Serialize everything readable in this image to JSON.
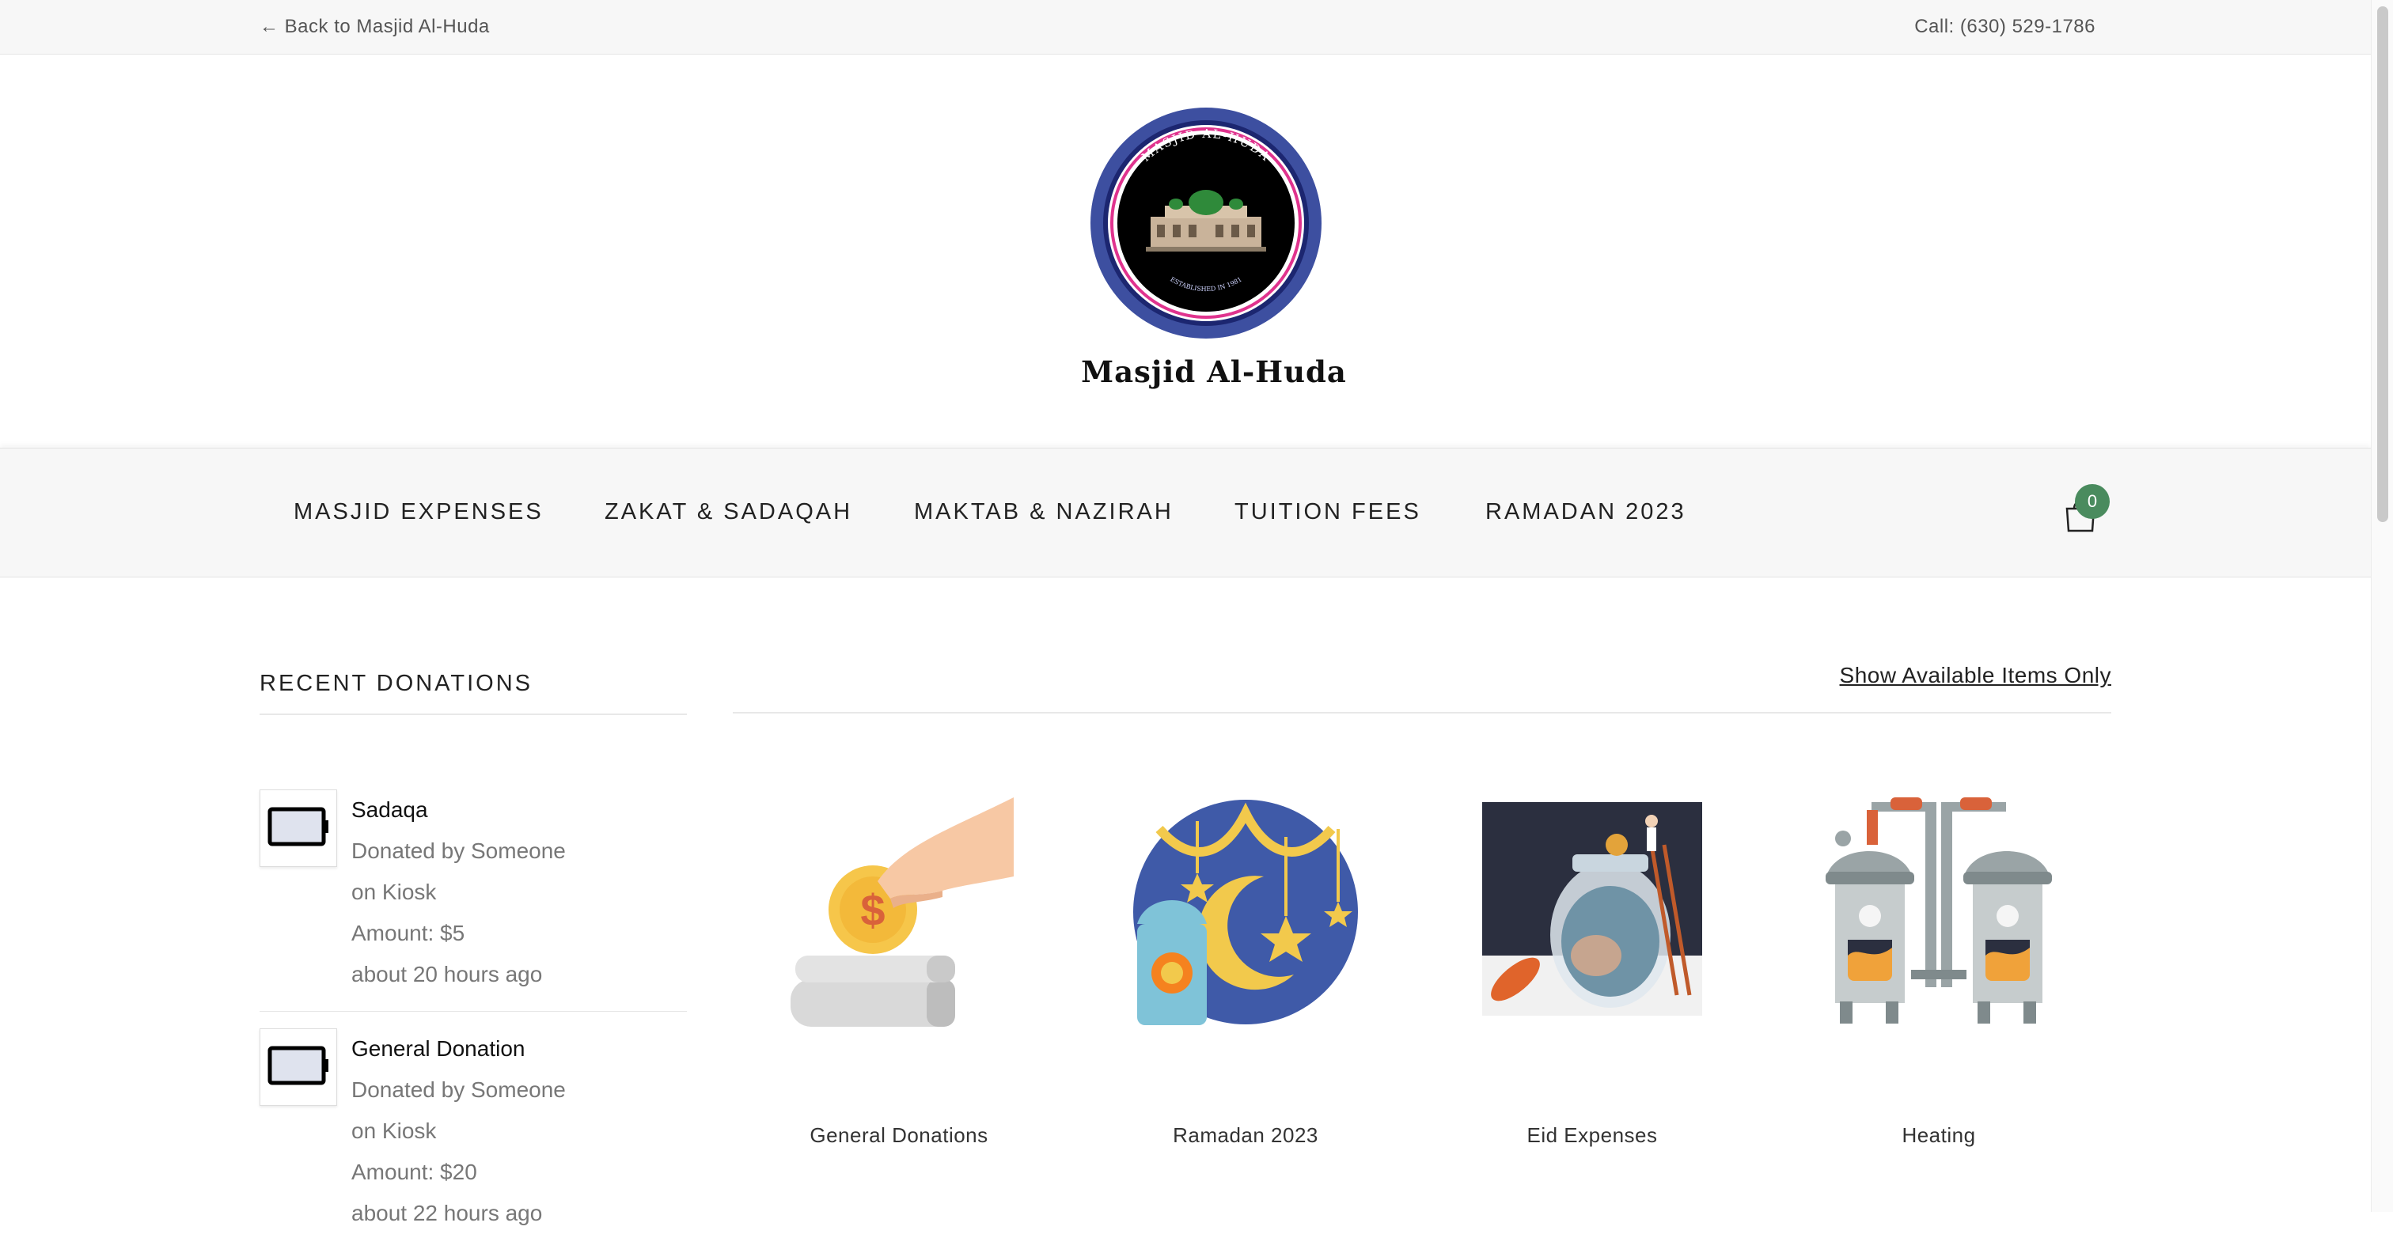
{
  "topbar": {
    "back_label": "← Back to Masjid Al-Huda",
    "phone": "Call: (630) 529-1786"
  },
  "brand": {
    "title": "Masjid Al-Huda",
    "logo_icon": "masjid-seal-logo",
    "logo_ring_text": "MASJID AL-HUDA",
    "logo_bottom_text": "ESTABLISHED IN 1981"
  },
  "nav": {
    "items": [
      {
        "label": "MASJID EXPENSES"
      },
      {
        "label": "ZAKAT & SADAQAH"
      },
      {
        "label": "MAKTAB & NAZIRAH"
      },
      {
        "label": "TUITION FEES"
      },
      {
        "label": "RAMADAN 2023"
      }
    ],
    "cart_icon": "shopping-bag-icon",
    "cart_count": "0"
  },
  "sidebar": {
    "title": "RECENT DONATIONS",
    "donations": [
      {
        "title": "Sadaqa",
        "by": "Donated by Someone",
        "via": "on Kiosk",
        "amount": "Amount: $5",
        "time": "about 20 hours ago",
        "icon": "battery-icon"
      },
      {
        "title": "General Donation",
        "by": "Donated by Someone",
        "via": "on Kiosk",
        "amount": "Amount: $20",
        "time": "about 22 hours ago",
        "icon": "battery-icon"
      }
    ]
  },
  "main": {
    "filter_link": "Show Available Items Only",
    "products": [
      {
        "label": "General Donations",
        "icon": "coin-donation-icon"
      },
      {
        "label": "Ramadan 2023",
        "icon": "crescent-lantern-icon"
      },
      {
        "label": "Eid Expenses",
        "icon": "jar-savings-icon"
      },
      {
        "label": "Heating",
        "icon": "boiler-heating-icon"
      }
    ]
  },
  "colors": {
    "topbar_bg": "#f7f7f7",
    "nav_bg": "#f7f7f7",
    "cart_badge": "#4a8b5e",
    "logo_ring": "#3d4fa0"
  }
}
